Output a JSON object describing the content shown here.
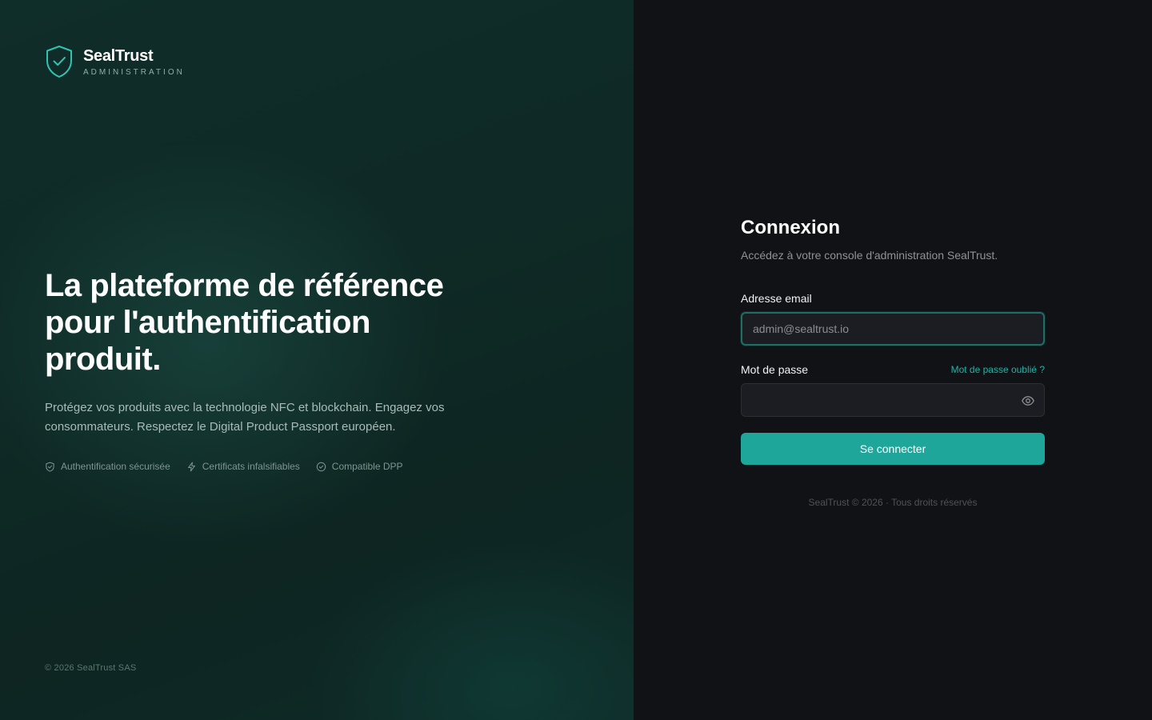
{
  "brand": {
    "name": "SealTrust",
    "subtitle": "ADMINISTRATION"
  },
  "hero": {
    "title": "La plateforme de référence pour l'authentification produit.",
    "description": "Protégez vos produits avec la technologie NFC et blockchain. Engagez vos consommateurs. Respectez le Digital Product Passport européen.",
    "features": [
      {
        "icon": "shield-check-icon",
        "label": "Authentification sécurisée"
      },
      {
        "icon": "lightning-icon",
        "label": "Certificats infalsifiables"
      },
      {
        "icon": "check-circle-icon",
        "label": "Compatible DPP"
      }
    ]
  },
  "left_footer": "© 2026 SealTrust SAS",
  "login": {
    "title": "Connexion",
    "subtitle": "Accédez à votre console d'administration SealTrust.",
    "email_label": "Adresse email",
    "email_placeholder": "admin@sealtrust.io",
    "password_label": "Mot de passe",
    "forgot_link": "Mot de passe oublié ?",
    "password_value": "",
    "submit_label": "Se connecter",
    "footer": "SealTrust © 2026 · Tous droits réservés"
  },
  "colors": {
    "accent": "#1fa69b",
    "link": "#20b3a6",
    "left_panel": "#0f2a26",
    "right_panel": "#111216"
  }
}
